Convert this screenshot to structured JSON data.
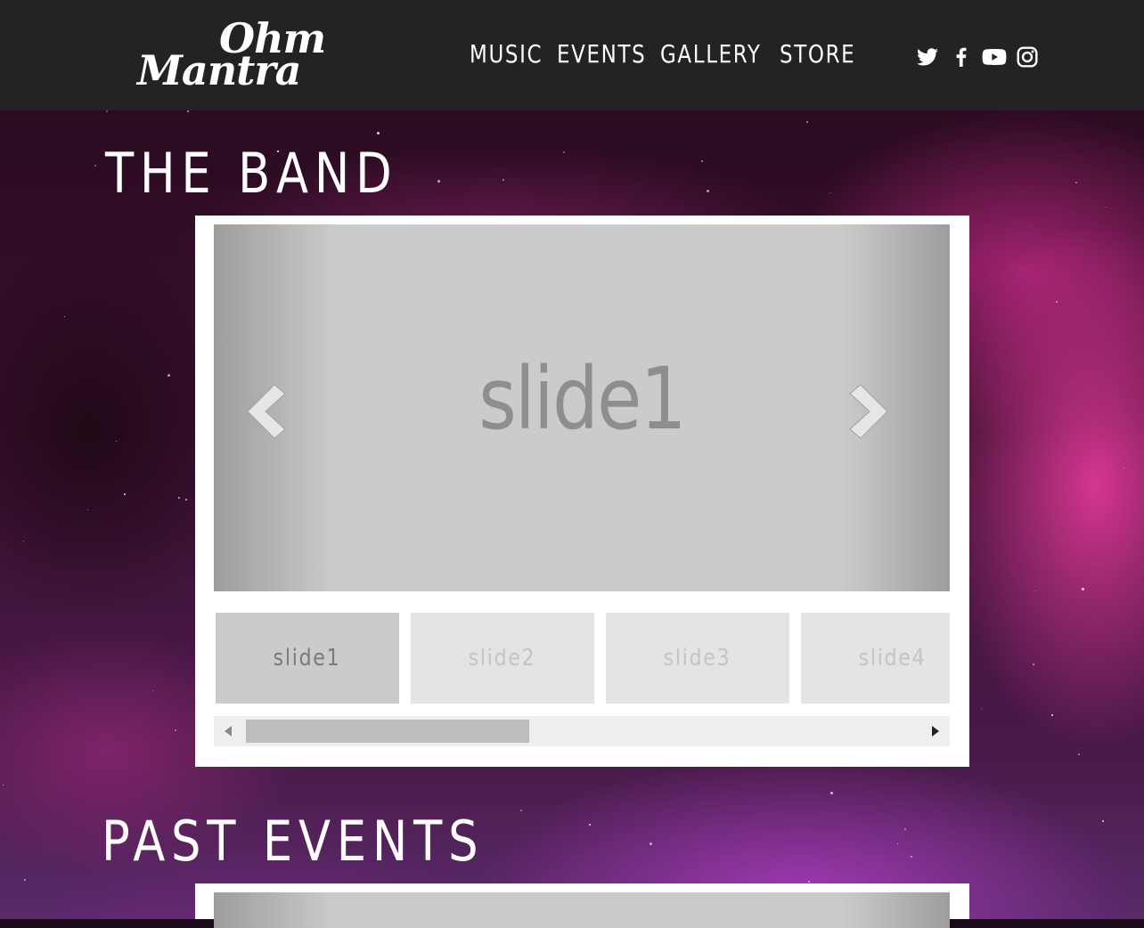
{
  "header": {
    "logo_line1": "Ohm",
    "logo_line2": "Mantra",
    "nav": [
      "MUSIC",
      "EVENTS",
      "GALLERY",
      "STORE"
    ],
    "social": [
      "twitter-icon",
      "facebook-icon",
      "youtube-icon",
      "instagram-icon"
    ]
  },
  "sections": {
    "band_title": "THE BAND",
    "past_events_title": "PAST EVENTS"
  },
  "slider": {
    "current_slide": "slide1",
    "thumbnails": [
      "slide1",
      "slide2",
      "slide3",
      "slide4"
    ],
    "active_index": 0
  },
  "colors": {
    "header_bg": "#232323",
    "frame_bg": "#ffffff",
    "slide_bg": "#cbcbcb"
  }
}
